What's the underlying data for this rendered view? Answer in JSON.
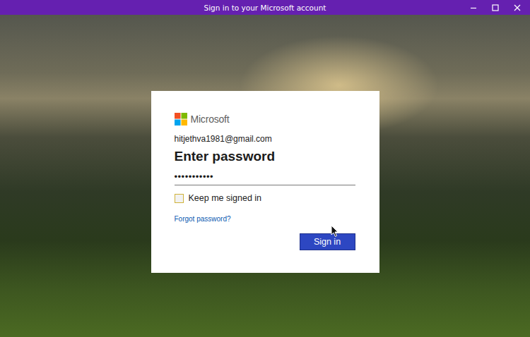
{
  "window": {
    "title": "Sign in to your Microsoft account"
  },
  "dialog": {
    "brand": "Microsoft",
    "account": "hitjethva1981@gmail.com",
    "heading": "Enter password",
    "password": {
      "value": "•••••••••••"
    },
    "keep_signed_in": {
      "label": "Keep me signed in",
      "checked": false,
      "focused": true
    },
    "forgot_link": "Forgot password?",
    "button": "Sign in"
  }
}
